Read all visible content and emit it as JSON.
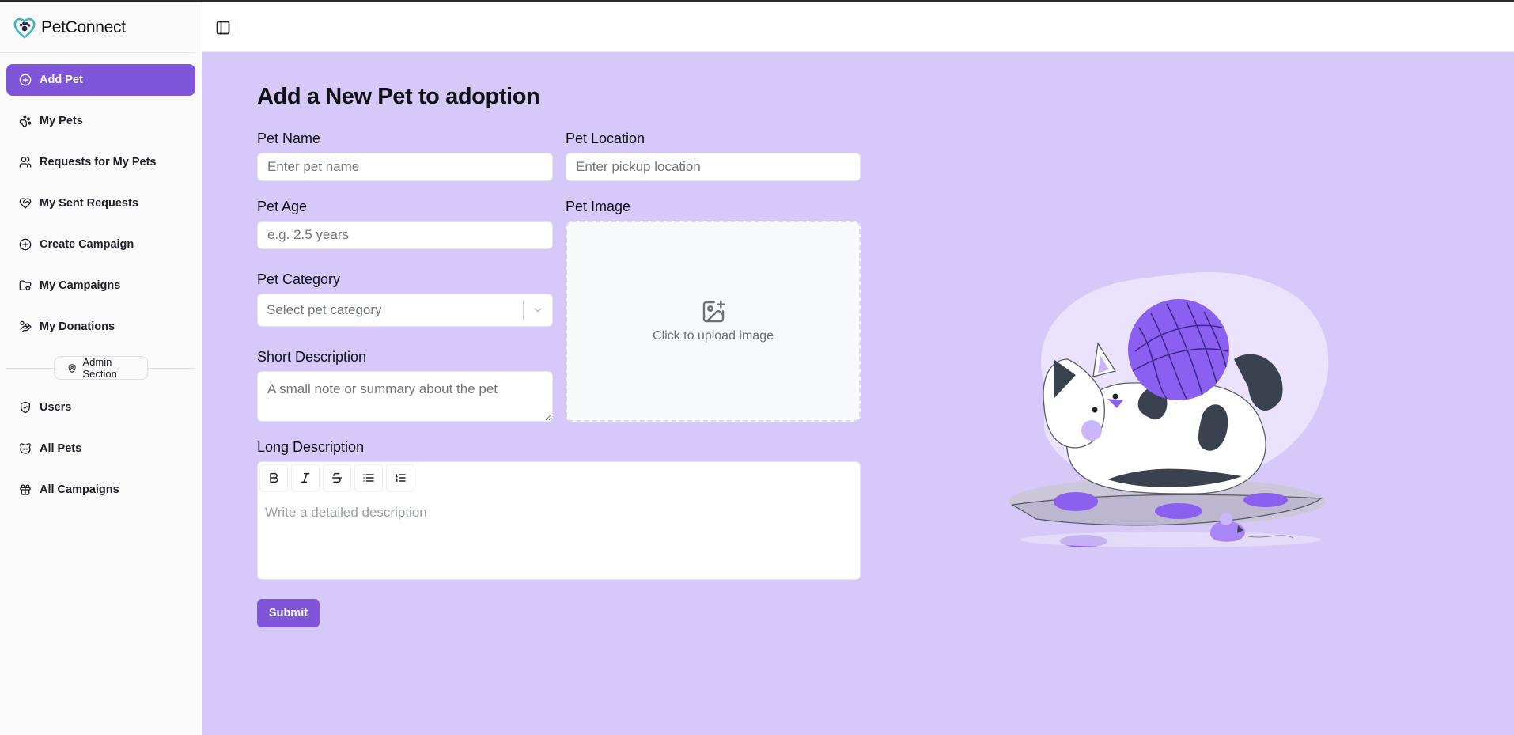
{
  "app": {
    "name": "PetConnect"
  },
  "sidebar": {
    "items": [
      {
        "label": "Add Pet",
        "icon": "plus-circle-icon",
        "active": true
      },
      {
        "label": "My Pets",
        "icon": "paw-icon"
      },
      {
        "label": "Requests for My Pets",
        "icon": "users-icon"
      },
      {
        "label": "My Sent Requests",
        "icon": "heart-handshake-icon"
      },
      {
        "label": "Create Campaign",
        "icon": "plus-circle-icon"
      },
      {
        "label": "My Campaigns",
        "icon": "folder-heart-icon"
      },
      {
        "label": "My Donations",
        "icon": "hand-coins-icon"
      }
    ],
    "admin_label": "Admin Section",
    "admin_items": [
      {
        "label": "Users",
        "icon": "shield-check-icon"
      },
      {
        "label": "All Pets",
        "icon": "cat-icon"
      },
      {
        "label": "All Campaigns",
        "icon": "gift-icon"
      }
    ]
  },
  "form": {
    "title": "Add a New Pet to adoption",
    "pet_name": {
      "label": "Pet Name",
      "placeholder": "Enter pet name"
    },
    "pet_location": {
      "label": "Pet Location",
      "placeholder": "Enter pickup location"
    },
    "pet_age": {
      "label": "Pet Age",
      "placeholder": "e.g. 2.5 years"
    },
    "pet_image": {
      "label": "Pet Image",
      "upload_text": "Click to upload image"
    },
    "pet_category": {
      "label": "Pet Category",
      "placeholder": "Select pet category"
    },
    "short_description": {
      "label": "Short Description",
      "placeholder": "A small note or summary about the pet"
    },
    "long_description": {
      "label": "Long Description",
      "placeholder": "Write a detailed description",
      "toolbar": [
        "bold-icon",
        "italic-icon",
        "strikethrough-icon",
        "bullet-list-icon",
        "numbered-list-icon"
      ]
    },
    "submit_label": "Submit"
  },
  "colors": {
    "accent": "#7f56d9",
    "main_background": "#d6c8f9",
    "sidebar_background": "#fafafa"
  }
}
